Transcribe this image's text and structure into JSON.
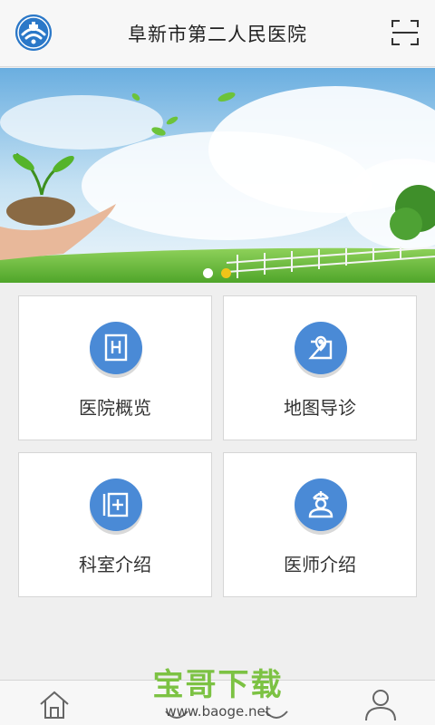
{
  "header": {
    "title": "阜新市第二人民医院",
    "logo_icon": "hospital-logo-icon",
    "scan_icon": "scan-icon"
  },
  "banner": {
    "slide_count": 2,
    "active_slide": 2,
    "dot_active_color": "#f0c419"
  },
  "menu": [
    {
      "label": "医院概览",
      "icon": "hospital-building-icon"
    },
    {
      "label": "地图导诊",
      "icon": "map-pin-icon"
    },
    {
      "label": "科室介绍",
      "icon": "department-icon"
    },
    {
      "label": "医师介绍",
      "icon": "doctor-icon"
    }
  ],
  "tabbar": {
    "icons": [
      "home-icon",
      "tab-icon",
      "tab-icon",
      "profile-icon"
    ]
  },
  "watermark": {
    "title": "宝哥下载",
    "url": "www.baoge.net"
  },
  "colors": {
    "accent": "#4a8ad6",
    "logo": "#2b78c8"
  }
}
